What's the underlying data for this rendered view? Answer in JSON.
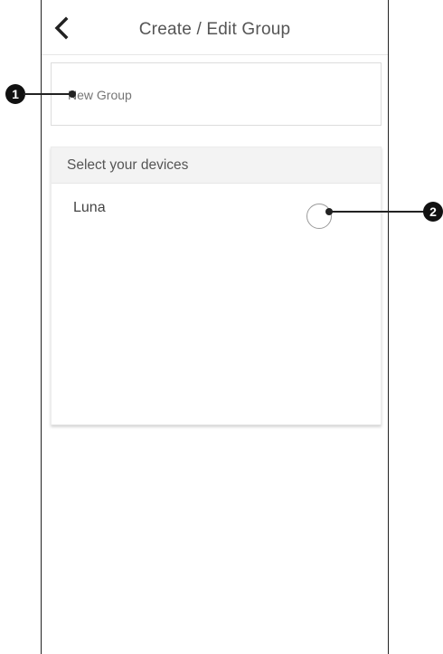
{
  "header": {
    "title": "Create / Edit Group",
    "back_icon": "chevron-left-icon"
  },
  "group_name": {
    "placeholder": "New Group",
    "value": ""
  },
  "devices": {
    "section_title": "Select your devices",
    "items": [
      {
        "label": "Luna",
        "selected": false
      }
    ]
  },
  "callouts": [
    {
      "number": "1"
    },
    {
      "number": "2"
    }
  ]
}
